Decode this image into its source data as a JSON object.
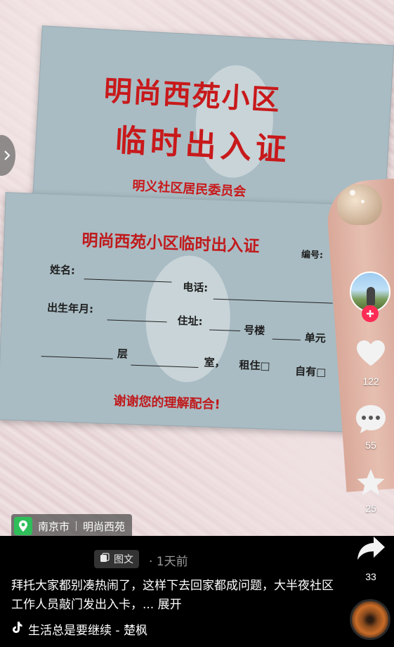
{
  "pass_card_back": {
    "title_line1": "明尚西苑小区",
    "title_line2": "临时出入证",
    "issuer": "明义社区居民委员会"
  },
  "pass_card_front": {
    "title": "明尚西苑小区临时出入证",
    "number_label": "编号:",
    "name_label": "姓名:",
    "phone_label": "电话:",
    "birth_label": "出生年月:",
    "address_label": "住址:",
    "building_label": "号楼",
    "unit_label": "单元",
    "floor_label": "层",
    "room_label": "室，",
    "rent_label": "租住□",
    "own_label": "自有□",
    "thanks": "谢谢您的理解配合!"
  },
  "location": {
    "city": "南京市",
    "place": "明尚西苑"
  },
  "actions": {
    "likes": "122",
    "comments": "55",
    "favorites": "25",
    "shares": "33"
  },
  "post": {
    "type_badge": "图文",
    "time": "· 1天前",
    "caption": "拜托大家都别凑热闹了，这样下去回家都成问题，大半夜社区工作人员敲门发出入卡，...",
    "expand": "展开",
    "music": "生活总是要继续 - 楚枫"
  },
  "colors": {
    "accent_red": "#fe2c55",
    "location_green": "#2fbe59",
    "card_blue_gray": "#a9bcc3",
    "stamp_red": "#c8191b"
  },
  "icons": {
    "like": "heart-icon",
    "comment": "chat-bubble-icon",
    "favorite": "star-icon",
    "share": "share-arrow-icon",
    "music": "tiktok-note-icon",
    "location": "location-pin-icon",
    "carousel_prev": "chevron-right-icon"
  }
}
